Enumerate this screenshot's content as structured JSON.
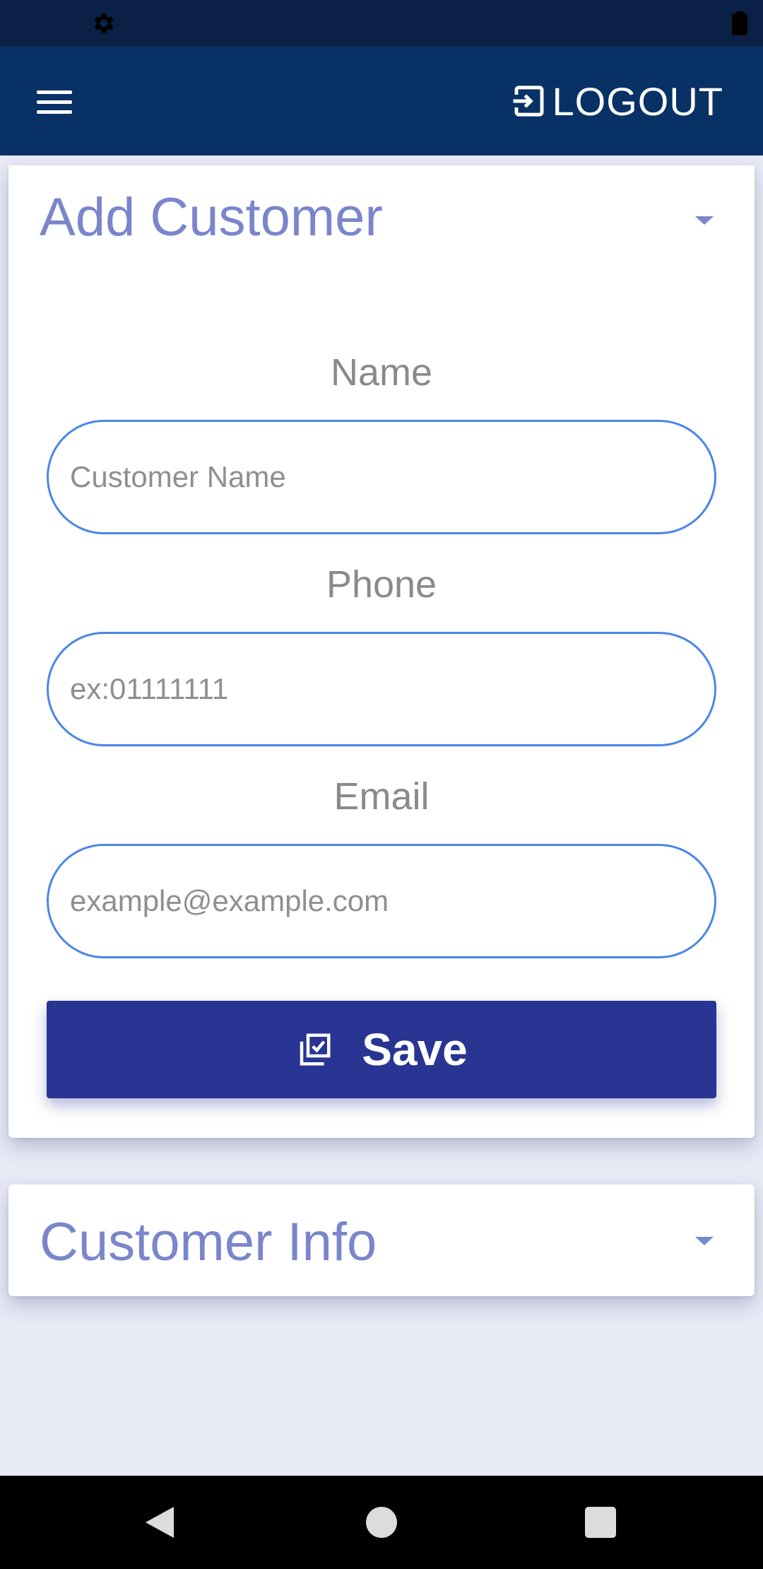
{
  "status_bar": {
    "icons": [
      "gear-icon",
      "battery-icon"
    ]
  },
  "app_bar": {
    "menu_icon": "hamburger-menu-icon",
    "logout_icon": "logout-arrow-icon",
    "logout_label": "LOGOUT"
  },
  "add_customer": {
    "title": "Add Customer",
    "expand_icon": "caret-down-icon",
    "fields": [
      {
        "label": "Name",
        "placeholder": "Customer Name",
        "value": ""
      },
      {
        "label": "Phone",
        "placeholder": "ex:01111111",
        "value": ""
      },
      {
        "label": "Email",
        "placeholder": "example@example.com",
        "value": ""
      }
    ],
    "save_button": {
      "icon": "checklist-save-icon",
      "label": "Save"
    }
  },
  "customer_info": {
    "title": "Customer Info",
    "expand_icon": "caret-down-icon"
  },
  "nav_bar": {
    "icons": [
      "back-triangle-icon",
      "home-circle-icon",
      "recent-square-icon"
    ]
  },
  "colors": {
    "status_bar": "#0b2046",
    "app_bar": "#083166",
    "title_accent": "#7986cb",
    "input_border": "#4a86e8",
    "save_button": "#283593",
    "page_background": "#e8eaf6"
  }
}
